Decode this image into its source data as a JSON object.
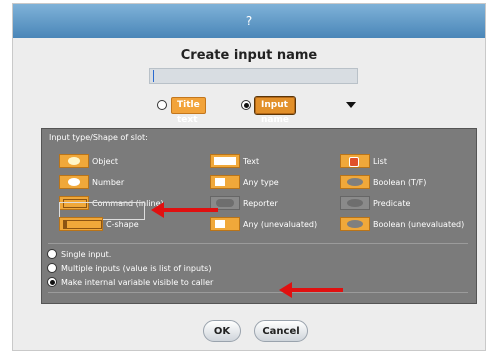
{
  "dialog": {
    "title": "?",
    "heading": "Create input name",
    "name_value": "",
    "mode": {
      "title_text": "Title text",
      "input_name": "Input name",
      "selected": "input_name"
    }
  },
  "panel": {
    "title": "Input type/Shape of slot:",
    "slots": [
      {
        "label": "Object",
        "icon": "object-icon"
      },
      {
        "label": "Text",
        "icon": "text-slot-icon"
      },
      {
        "label": "List",
        "icon": "list-icon"
      },
      {
        "label": "Number",
        "icon": "number-slot-icon"
      },
      {
        "label": "Any type",
        "icon": "any-type-icon"
      },
      {
        "label": "Boolean (T/F)",
        "icon": "boolean-icon"
      },
      {
        "label": "Command (inline)",
        "icon": "command-inline-icon"
      },
      {
        "label": "Reporter",
        "icon": "reporter-icon"
      },
      {
        "label": "Predicate",
        "icon": "predicate-icon"
      },
      {
        "label": "C-shape",
        "icon": "c-shape-icon"
      },
      {
        "label": "Any (unevaluated)",
        "icon": "any-unevaluated-icon"
      },
      {
        "label": "Boolean (unevaluated)",
        "icon": "boolean-unevaluated-icon"
      }
    ],
    "selected_slot": "C-shape",
    "options": {
      "single": "Single input.",
      "multiple": "Multiple inputs (value is list of inputs)",
      "visible": "Make internal variable visible to caller",
      "selected": "visible"
    }
  },
  "buttons": {
    "ok": "OK",
    "cancel": "Cancel"
  },
  "colors": {
    "arrow": "#e01010",
    "slot_orange": "#f0a83a",
    "panel_bg": "#7b7b7b",
    "title_bar": "#4a86b8"
  }
}
